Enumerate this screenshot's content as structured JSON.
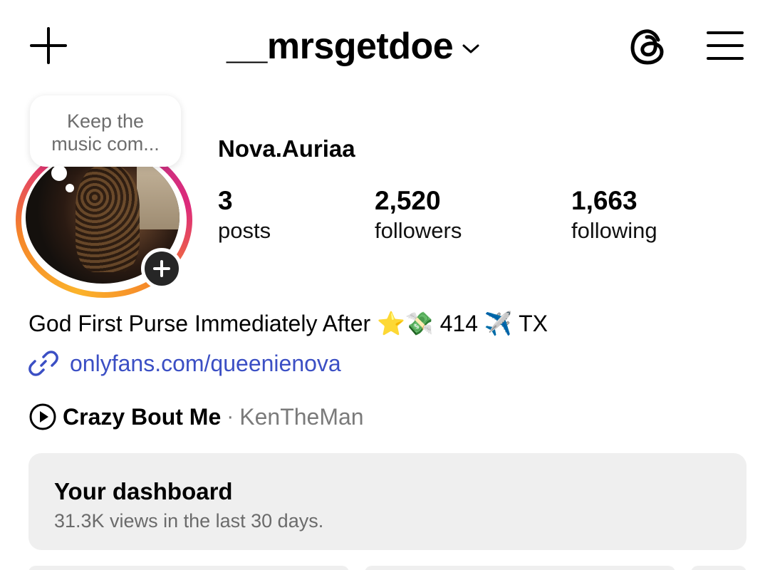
{
  "header": {
    "username": "__mrsgetdoe"
  },
  "note": {
    "text_line1": "Keep the",
    "text_line2": "music com..."
  },
  "profile": {
    "display_name": "Nova.Auriaa",
    "stats": [
      {
        "value": "3",
        "label": "posts"
      },
      {
        "value": "2,520",
        "label": "followers"
      },
      {
        "value": "1,663",
        "label": "following"
      }
    ],
    "bio": "God First Purse Immediately After ⭐💸 414 ✈️ TX",
    "link": "onlyfans.com/queenienova",
    "music": {
      "song": "Crazy Bout Me",
      "separator": "·",
      "artist": "KenTheMan"
    }
  },
  "dashboard": {
    "title": "Your dashboard",
    "subtitle": "31.3K views in the last 30 days."
  },
  "colors": {
    "link": "#3b4fc4",
    "muted": "#6b6b6b",
    "card": "#efefef"
  }
}
